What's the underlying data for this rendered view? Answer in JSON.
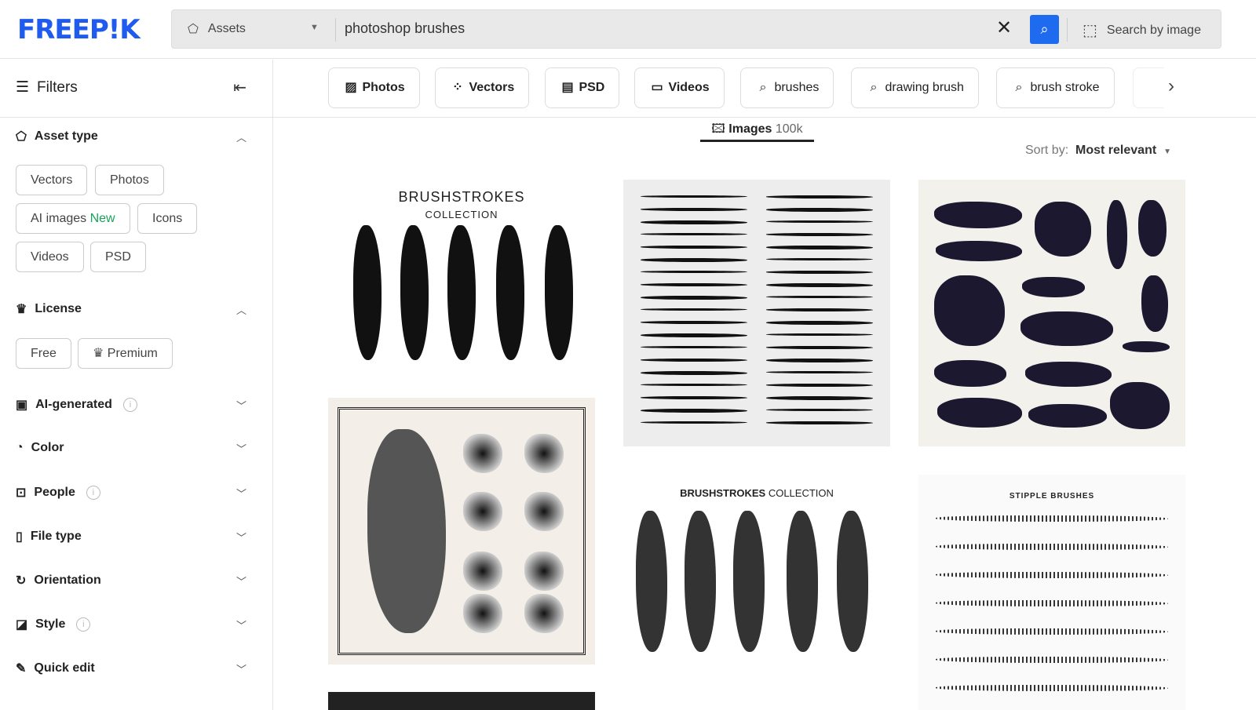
{
  "header": {
    "logo": "FREEP!K",
    "asset_selector": "Assets",
    "query": "photoshop brushes",
    "search_by_image": "Search by image",
    "accent": "#1f6bf0"
  },
  "sidebar": {
    "title": "Filters",
    "asset_type": {
      "label": "Asset type",
      "options": [
        "Vectors",
        "Photos",
        "AI images",
        "Icons",
        "Videos",
        "PSD"
      ],
      "new_badge": "New"
    },
    "license": {
      "label": "License",
      "options": [
        "Free",
        "Premium"
      ]
    },
    "sections": [
      {
        "label": "AI-generated",
        "icon": "ai-icon",
        "info": true
      },
      {
        "label": "Color",
        "icon": "palette-icon",
        "info": false
      },
      {
        "label": "People",
        "icon": "person-icon",
        "info": true
      },
      {
        "label": "File type",
        "icon": "file-icon",
        "info": false
      },
      {
        "label": "Orientation",
        "icon": "rotate-icon",
        "info": false
      },
      {
        "label": "Style",
        "icon": "style-icon",
        "info": true
      },
      {
        "label": "Quick edit",
        "icon": "brush-icon",
        "info": false
      }
    ]
  },
  "chips": [
    {
      "label": "Photos",
      "icon": "▨",
      "bold": true
    },
    {
      "label": "Vectors",
      "icon": "⁘",
      "bold": true
    },
    {
      "label": "PSD",
      "icon": "▤",
      "bold": true
    },
    {
      "label": "Videos",
      "icon": "▭",
      "bold": true
    },
    {
      "label": "brushes",
      "icon": "⌕",
      "bold": false
    },
    {
      "label": "drawing brush",
      "icon": "⌕",
      "bold": false
    },
    {
      "label": "brush stroke",
      "icon": "⌕",
      "bold": false
    }
  ],
  "tab": {
    "label": "Images",
    "count": "100k"
  },
  "sort": {
    "label": "Sort by:",
    "value": "Most relevant"
  },
  "cards": {
    "c1": "BRUSHSTROKES",
    "c1b": "COLLECTION",
    "c5": "BRUSHSTROKES",
    "c5b": "COLLECTION",
    "c6": "STIPPLE BRUSHES"
  }
}
